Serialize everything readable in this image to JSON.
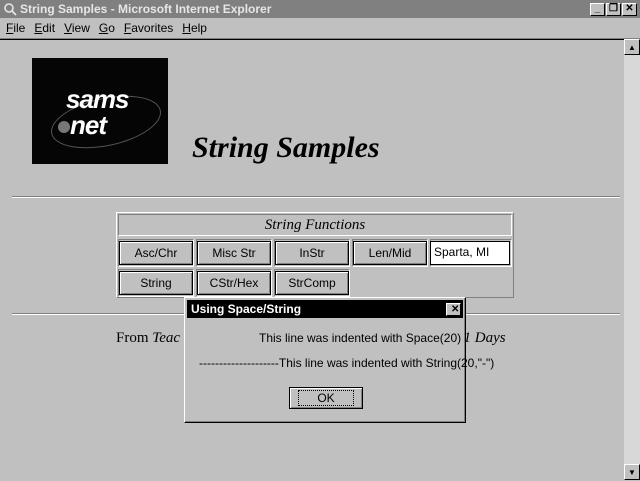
{
  "window": {
    "title": "String Samples - Microsoft Internet Explorer"
  },
  "menu": [
    {
      "accel": "F",
      "rest": "ile"
    },
    {
      "accel": "E",
      "rest": "dit"
    },
    {
      "accel": "V",
      "rest": "iew"
    },
    {
      "accel": "G",
      "rest": "o"
    },
    {
      "accel": "F",
      "rest": "avorites"
    },
    {
      "accel": "H",
      "rest": "elp"
    }
  ],
  "logo": {
    "line1": "sams",
    "line2": "net"
  },
  "page": {
    "title": "String Samples"
  },
  "functions": {
    "header": "String Functions",
    "buttons": [
      "Asc/Chr",
      "Misc Str",
      "InStr",
      "Len/Mid",
      "String",
      "CStr/Hex",
      "StrComp"
    ],
    "input_value": "Sparta, MI"
  },
  "footer": {
    "prefix": "From ",
    "italic_part": "Teac",
    "suffix_italic": "21 Days"
  },
  "dialog": {
    "title": "Using Space/String",
    "line1": "This line was indented with Space(20)",
    "line2": "--------------------This line was indented with String(20,\"-\")",
    "ok_label": "OK"
  }
}
